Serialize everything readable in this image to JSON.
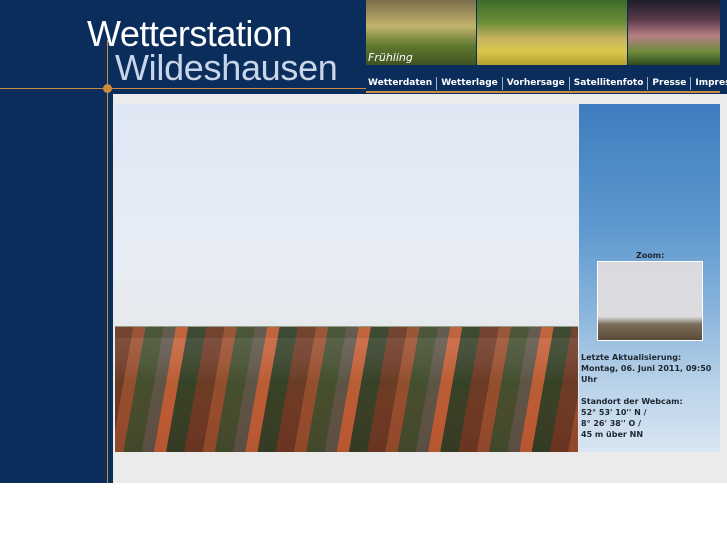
{
  "header": {
    "logo_line1": "Wetterstation",
    "logo_line2": "Wildeshausen",
    "season_caption": "Frühling"
  },
  "nav": {
    "items": [
      "Wetterdaten",
      "Wetterlage",
      "Vorhersage",
      "Satellitenfoto",
      "Presse",
      "Impressum"
    ]
  },
  "sidebar": {
    "zoom_label": "Zoom:",
    "update_label": "Letzte Aktualisierung:",
    "update_value": "Montag, 06. Juni 2011, 09:50 Uhr",
    "standort_label": "Standort der Webcam:",
    "lat": "52° 53' 10'' N /",
    "lon": "8° 26' 38'' O /",
    "alt": "45 m über NN"
  },
  "colors": {
    "frame": "#0b2d5c",
    "accent": "#c98b45",
    "content_bg": "#ebebeb"
  }
}
